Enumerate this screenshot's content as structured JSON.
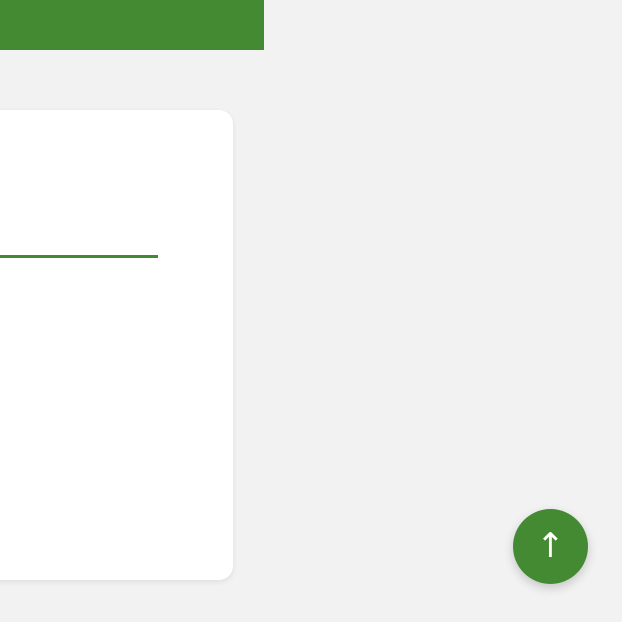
{
  "banner": {
    "color": "#438a33"
  },
  "card": {
    "background": "#ffffff",
    "divider_color": "#438a33"
  },
  "scroll_top_button": {
    "icon": "arrow-up-icon",
    "glyph": "↑",
    "color": "#438a33"
  },
  "page": {
    "background": "#f2f2f2"
  }
}
